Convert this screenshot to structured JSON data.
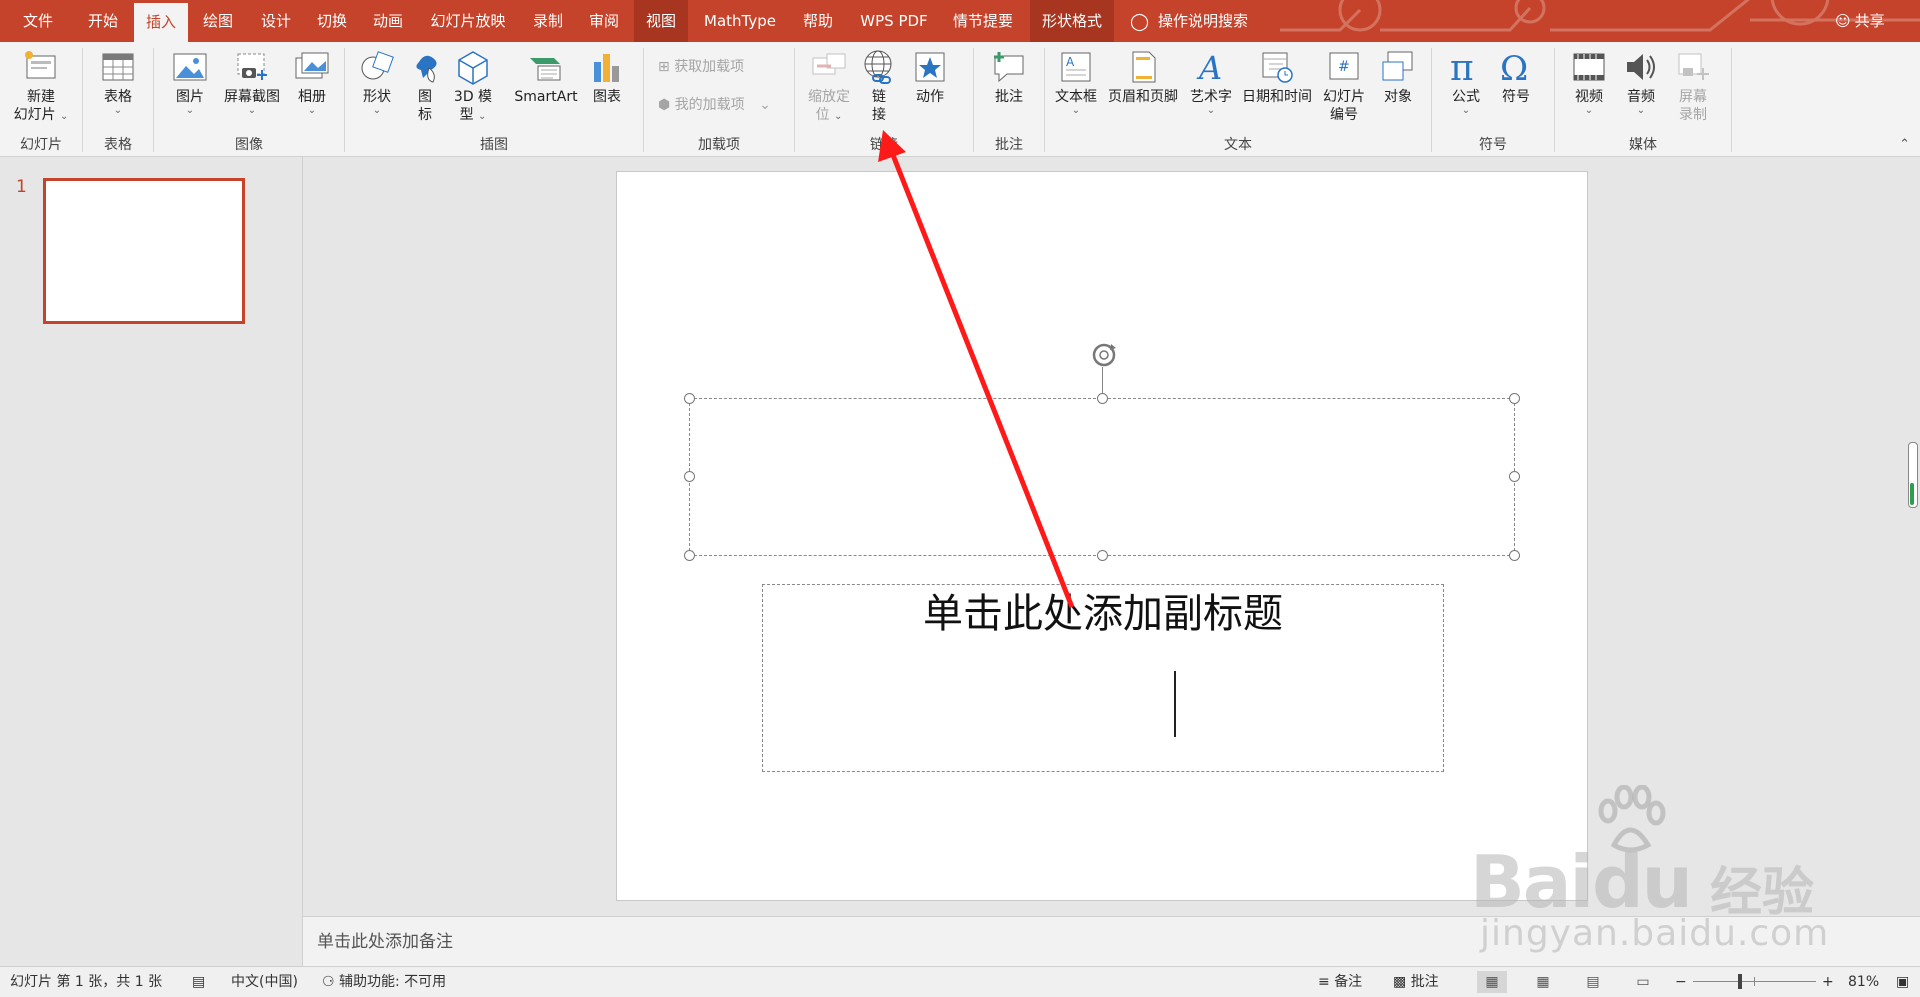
{
  "tabs": [
    {
      "label": "文件"
    },
    {
      "label": "开始"
    },
    {
      "label": "插入",
      "active": true
    },
    {
      "label": "绘图"
    },
    {
      "label": "设计"
    },
    {
      "label": "切换"
    },
    {
      "label": "动画"
    },
    {
      "label": "幻灯片放映"
    },
    {
      "label": "录制"
    },
    {
      "label": "审阅"
    },
    {
      "label": "视图",
      "context": true
    },
    {
      "label": "MathType"
    },
    {
      "label": "帮助"
    },
    {
      "label": "WPS PDF"
    },
    {
      "label": "情节提要"
    },
    {
      "label": "形状格式",
      "context": true
    }
  ],
  "search_label": "操作说明搜索",
  "share_label": "共享",
  "ribbon": {
    "groups": {
      "slides": "幻灯片",
      "tables": "表格",
      "images": "图像",
      "illustrations": "插图",
      "addins": "加载项",
      "links": "链接",
      "comments": "批注",
      "text": "文本",
      "symbols": "符号",
      "media": "媒体"
    },
    "buttons": {
      "new_slide_1": "新建",
      "new_slide_2": "幻灯片",
      "table": "表格",
      "picture": "图片",
      "screenshot": "屏幕截图",
      "album": "相册",
      "shapes": "形状",
      "icons_1": "图",
      "icons_2": "标",
      "model3d_1": "3D 模",
      "model3d_2": "型",
      "smartart": "SmartArt",
      "chart": "图表",
      "get_addins": "获取加载项",
      "my_addins": "我的加载项",
      "zoom_1": "缩放定",
      "zoom_2": "位",
      "link_1": "链",
      "link_2": "接",
      "action": "动作",
      "comment": "批注",
      "textbox": "文本框",
      "header_footer": "页眉和页脚",
      "wordart": "艺术字",
      "datetime": "日期和时间",
      "slide_num_1": "幻灯片",
      "slide_num_2": "编号",
      "object": "对象",
      "equation": "公式",
      "symbol": "符号",
      "video": "视频",
      "audio": "音频",
      "screen_rec_1": "屏幕",
      "screen_rec_2": "录制"
    }
  },
  "thumbnail_number": "1",
  "slide": {
    "subtitle_placeholder": "单击此处添加副标题"
  },
  "notes_placeholder": "单击此处添加备注",
  "status": {
    "slide_info": "幻灯片 第 1 张，共 1 张",
    "language": "中文(中国)",
    "accessibility": "辅助功能: 不可用",
    "notes": "备注",
    "comments": "批注",
    "zoom": "81%"
  },
  "watermark": {
    "brand": "Baidu",
    "cn": "经验",
    "url": "jingyan.baidu.com"
  },
  "colors": {
    "accent": "#c6432b",
    "arrow": "#ff1a1a"
  }
}
